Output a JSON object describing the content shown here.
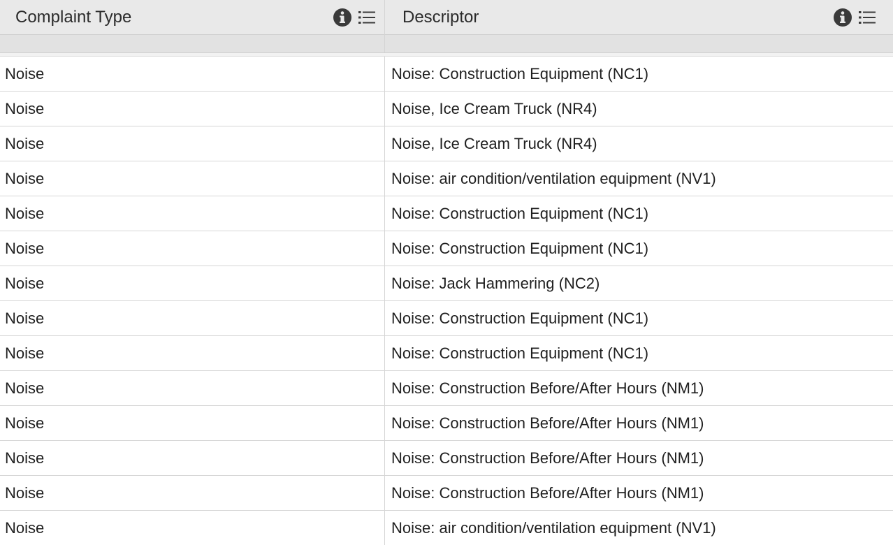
{
  "columns": [
    {
      "label": "Complaint Type",
      "icons": [
        "info-icon",
        "list-icon"
      ]
    },
    {
      "label": "Descriptor",
      "icons": [
        "info-icon",
        "list-icon"
      ]
    }
  ],
  "rows": [
    {
      "complaint_type": "Noise",
      "descriptor": "Noise: Construction Equipment (NC1)"
    },
    {
      "complaint_type": "Noise",
      "descriptor": "Noise, Ice Cream Truck (NR4)"
    },
    {
      "complaint_type": "Noise",
      "descriptor": "Noise, Ice Cream Truck (NR4)"
    },
    {
      "complaint_type": "Noise",
      "descriptor": "Noise: air condition/ventilation equipment (NV1)"
    },
    {
      "complaint_type": "Noise",
      "descriptor": "Noise: Construction Equipment (NC1)"
    },
    {
      "complaint_type": "Noise",
      "descriptor": "Noise: Construction Equipment (NC1)"
    },
    {
      "complaint_type": "Noise",
      "descriptor": "Noise: Jack Hammering (NC2)"
    },
    {
      "complaint_type": "Noise",
      "descriptor": "Noise: Construction Equipment (NC1)"
    },
    {
      "complaint_type": "Noise",
      "descriptor": "Noise: Construction Equipment (NC1)"
    },
    {
      "complaint_type": "Noise",
      "descriptor": "Noise: Construction Before/After Hours (NM1)"
    },
    {
      "complaint_type": "Noise",
      "descriptor": "Noise: Construction Before/After Hours (NM1)"
    },
    {
      "complaint_type": "Noise",
      "descriptor": "Noise: Construction Before/After Hours (NM1)"
    },
    {
      "complaint_type": "Noise",
      "descriptor": "Noise: Construction Before/After Hours (NM1)"
    },
    {
      "complaint_type": "Noise",
      "descriptor": "Noise: air condition/ventilation equipment (NV1)"
    }
  ],
  "colors": {
    "header_bg": "#e9e9e9",
    "filter_bg": "#e2e2e2",
    "icon": "#3a3a3a",
    "border": "#d6d6d6"
  }
}
